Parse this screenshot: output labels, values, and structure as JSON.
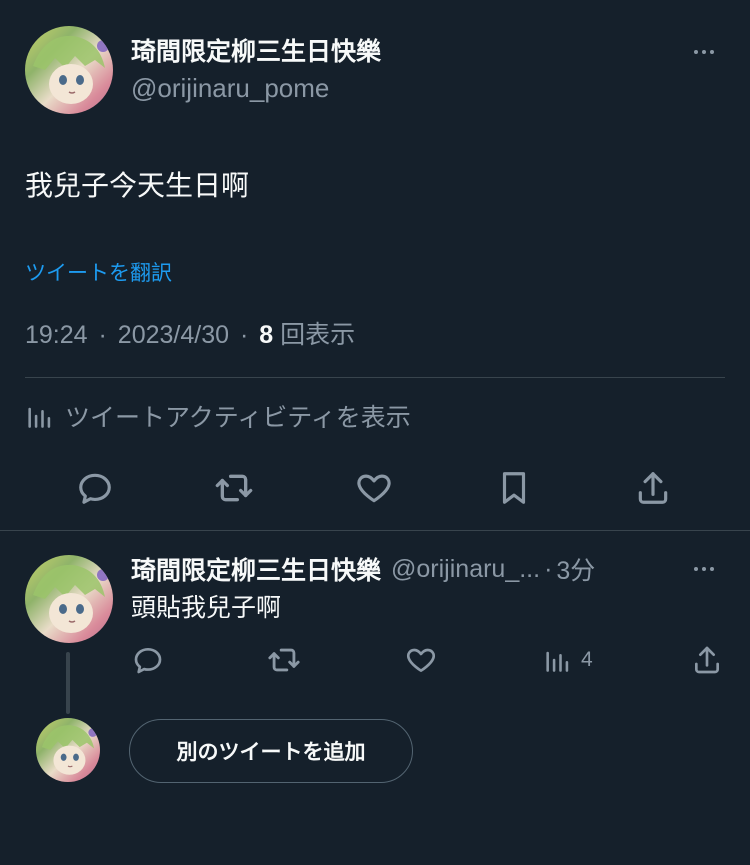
{
  "main_tweet": {
    "display_name": "琦間限定柳三生日快樂",
    "handle": "@orijinaru_pome",
    "text": "我兒子今天生日啊",
    "translate_label": "ツイートを翻訳",
    "time": "19:24",
    "date": "2023/4/30",
    "view_count": "8",
    "views_label": "回表示",
    "separator": "·",
    "activity_label": "ツイートアクティビティを表示"
  },
  "reply": {
    "display_name": "琦間限定柳三生日快樂",
    "handle": "@orijinaru_...",
    "separator": "·",
    "time": "3分",
    "text": "頭貼我兒子啊",
    "view_count": "4"
  },
  "compose": {
    "add_tweet_label": "別のツイートを追加"
  },
  "colors": {
    "background": "#15202b",
    "text": "#f7f9f9",
    "secondary": "#8b98a5",
    "accent": "#1d9bf0",
    "divider": "#38444d"
  }
}
